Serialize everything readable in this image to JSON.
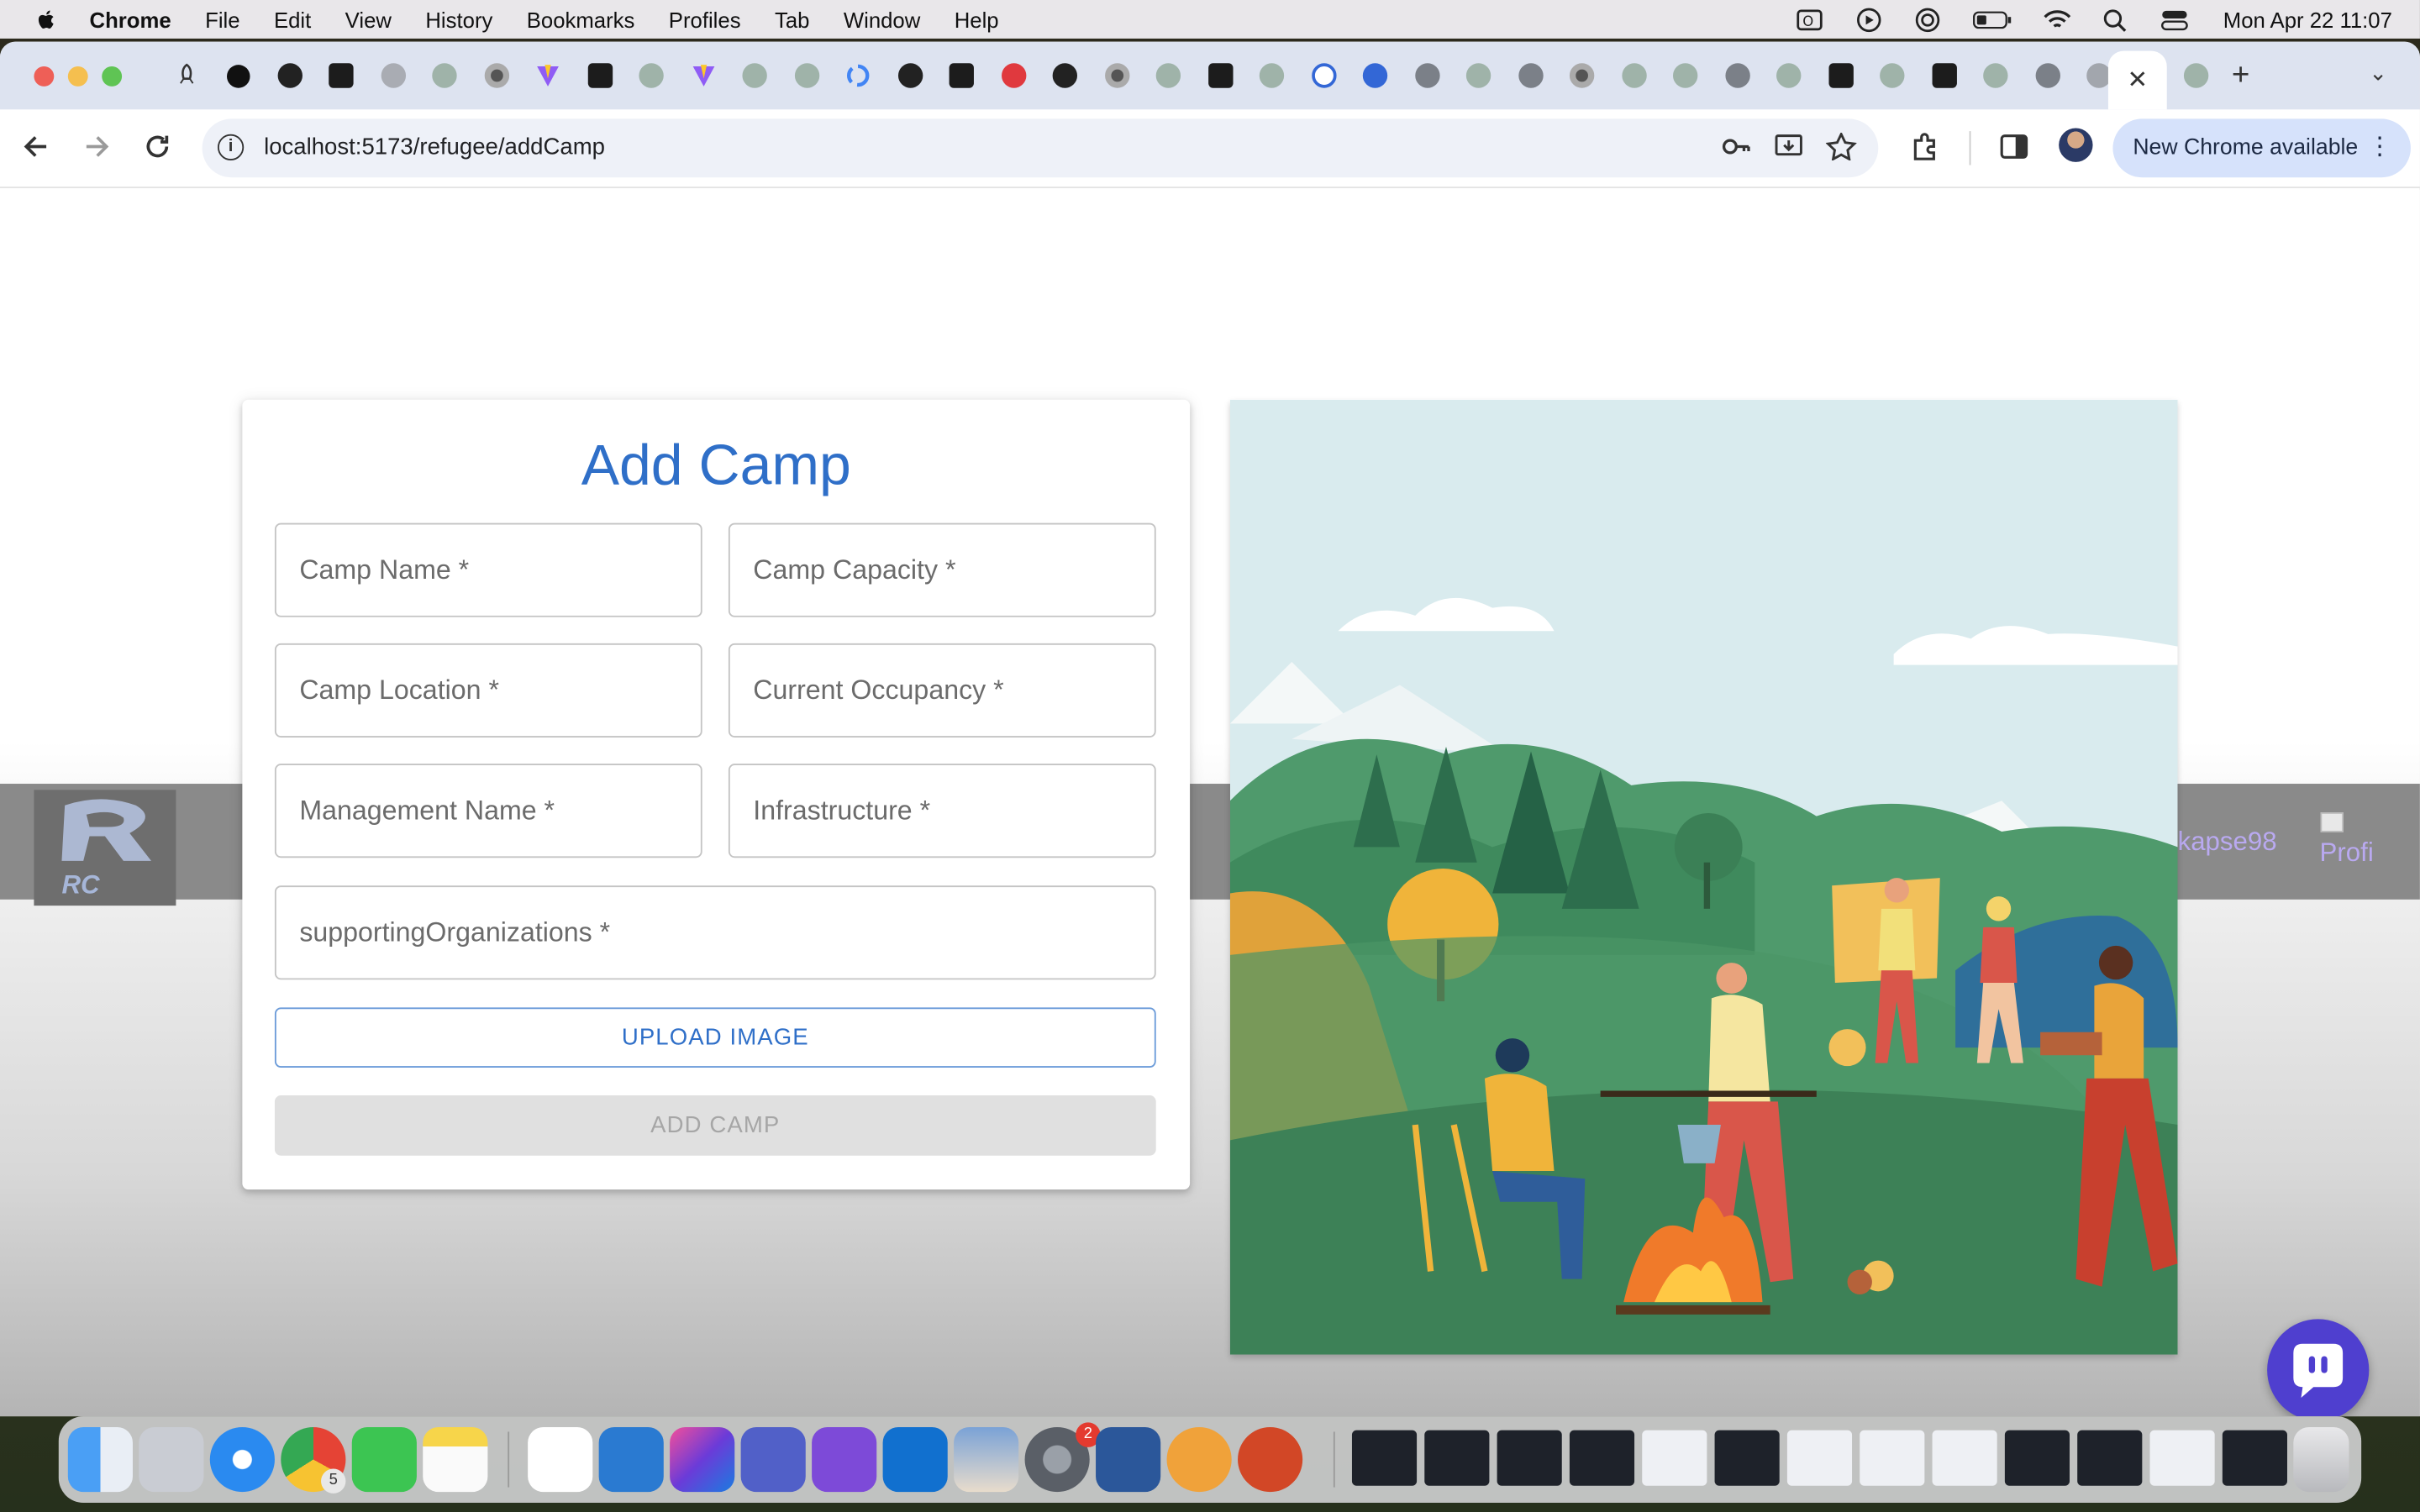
{
  "menubar": {
    "app_name": "Chrome",
    "menus": [
      "File",
      "Edit",
      "View",
      "History",
      "Bookmarks",
      "Profiles",
      "Tab",
      "Window",
      "Help"
    ],
    "clock": "Mon Apr 22  11:07"
  },
  "browser": {
    "url": "localhost:5173/refugee/addCamp",
    "new_chrome_label": "New Chrome available",
    "active_tab_close": "✕",
    "new_tab": "+",
    "tab_menu": "⌄"
  },
  "site_header": {
    "logo_text": "RC",
    "username_fragment": "kapse98",
    "profile_alt_fragment": "Profi"
  },
  "form": {
    "title": "Add Camp",
    "fields": {
      "camp_name": "Camp Name *",
      "camp_capacity": "Camp Capacity *",
      "camp_location": "Camp Location *",
      "current_occupancy": "Current Occupancy *",
      "management_name": "Management Name *",
      "infrastructure": "Infrastructure *",
      "supporting_organizations": "supportingOrganizations *"
    },
    "upload_label": "UPLOAD IMAGE",
    "submit_label": "ADD CAMP"
  },
  "dock": {
    "badges": {
      "chrome": "5",
      "system_settings": "2"
    }
  },
  "colors": {
    "accent": "#2f6fc8",
    "chat_button": "#4f3fcf",
    "nav_band": "#8a8a8a"
  }
}
